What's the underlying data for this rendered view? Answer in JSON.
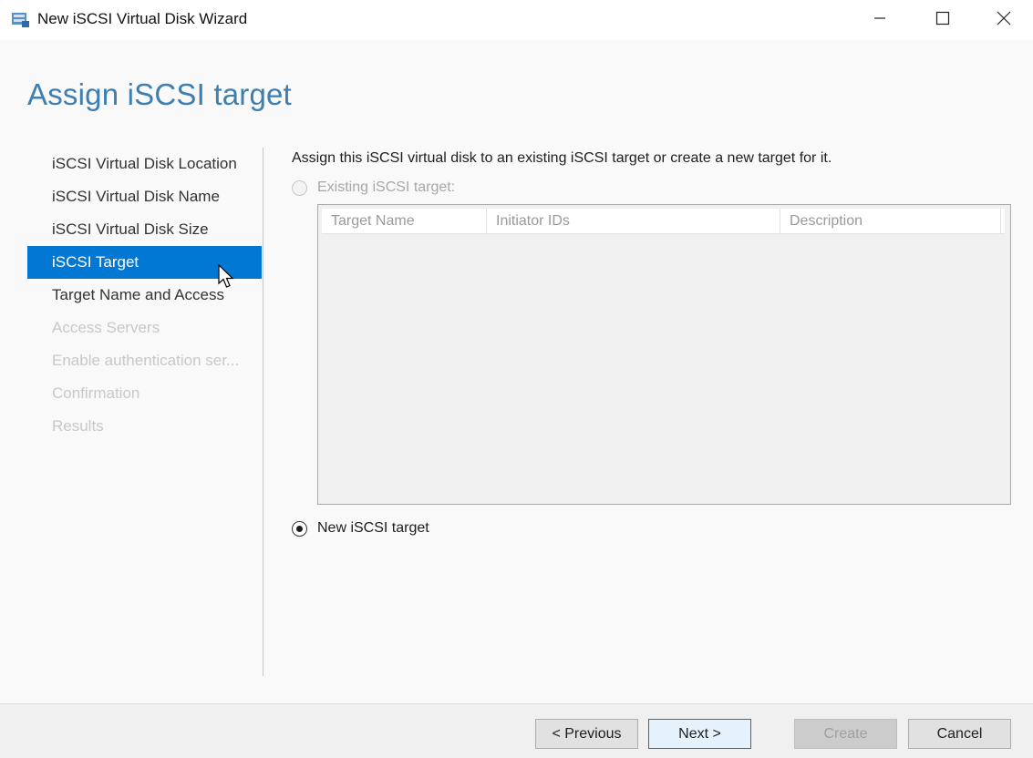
{
  "window": {
    "title": "New iSCSI Virtual Disk Wizard"
  },
  "page": {
    "title": "Assign iSCSI target"
  },
  "nav": {
    "items": [
      {
        "label": "iSCSI Virtual Disk Location",
        "state": "done"
      },
      {
        "label": "iSCSI Virtual Disk Name",
        "state": "done"
      },
      {
        "label": "iSCSI Virtual Disk Size",
        "state": "done"
      },
      {
        "label": "iSCSI Target",
        "state": "active"
      },
      {
        "label": "Target Name and Access",
        "state": "enabled"
      },
      {
        "label": "Access Servers",
        "state": "disabled"
      },
      {
        "label": "Enable authentication ser...",
        "state": "disabled"
      },
      {
        "label": "Confirmation",
        "state": "disabled"
      },
      {
        "label": "Results",
        "state": "disabled"
      }
    ]
  },
  "main": {
    "instruction": "Assign this iSCSI virtual disk to an existing iSCSI target or create a new target for it.",
    "existing_option": {
      "label": "Existing iSCSI target:",
      "checked": false,
      "enabled": false
    },
    "new_option": {
      "label": "New iSCSI target",
      "checked": true,
      "enabled": true
    },
    "table": {
      "columns": [
        "Target Name",
        "Initiator IDs",
        "Description"
      ],
      "rows": []
    }
  },
  "footer": {
    "previous_label": "< Previous",
    "next_label": "Next >",
    "create_label": "Create",
    "cancel_label": "Cancel"
  },
  "colors": {
    "accent": "#0078d4",
    "title": "#3f7fb0"
  }
}
